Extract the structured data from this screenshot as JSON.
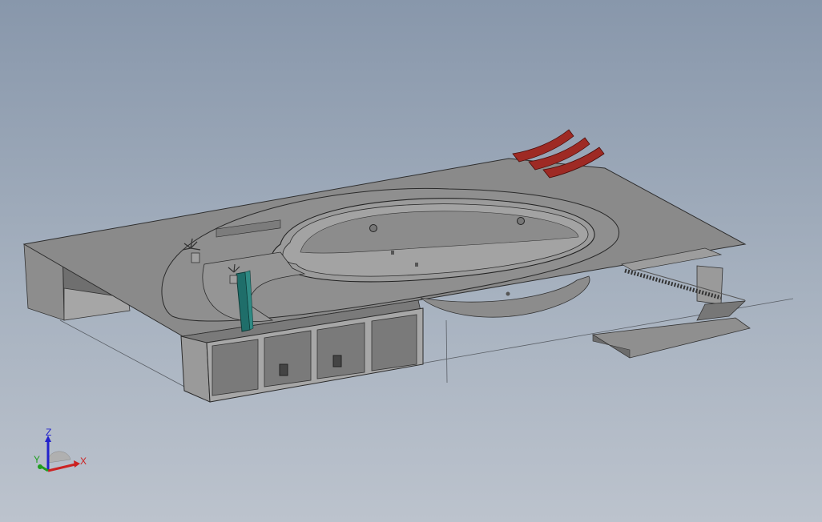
{
  "viewport": {
    "background_top": "#8897ab",
    "background_bottom": "#bcc3cd"
  },
  "model": {
    "body_color": "#8a8a8a",
    "pool_color": "#9a9a9a",
    "chair_color": "#9e2a24",
    "slide_color": "#1f6e6a"
  },
  "triad": {
    "z_label": "Z",
    "y_label": "Y",
    "x_label": "X",
    "z_color": "#2222cc",
    "y_color": "#1e9e1e",
    "x_color": "#cc2222"
  }
}
